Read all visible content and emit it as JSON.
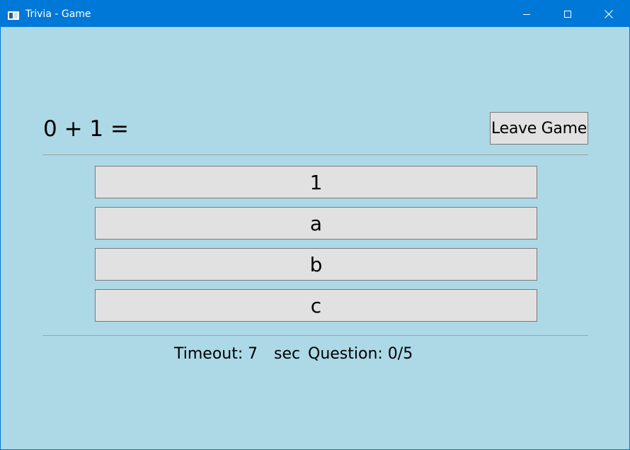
{
  "window": {
    "title": "Trivia - Game",
    "colors": {
      "titlebar": "#0078D7",
      "background": "#ADD8E6",
      "button_face": "#E1E1E1",
      "button_border": "#7A7A7A"
    },
    "icons": {
      "app": "window-app-icon",
      "minimize": "minimize-icon",
      "maximize": "maximize-icon",
      "close": "close-icon"
    }
  },
  "game": {
    "question": "0 + 1 =",
    "leave_label": "Leave Game",
    "answers": [
      "1",
      "a",
      "b",
      "c"
    ]
  },
  "status": {
    "timeout_label": "Timeout:",
    "timeout_value": "7",
    "sec_label": "sec",
    "question_counter": "Question: 0/5"
  }
}
